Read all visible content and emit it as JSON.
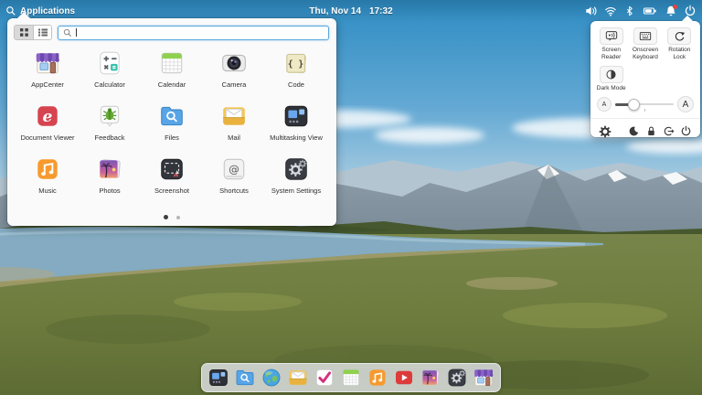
{
  "topbar": {
    "app_menu_label": "Applications",
    "date": "Thu, Nov 14",
    "time": "17:32",
    "tray_icons": [
      "volume-icon",
      "wifi-icon",
      "bluetooth-icon",
      "battery-icon",
      "notifications-icon",
      "power-icon"
    ],
    "notification_badge_color": "#e2453e"
  },
  "launcher": {
    "view_toggles": [
      "grid-view",
      "category-view"
    ],
    "search": {
      "value": "",
      "placeholder": ""
    },
    "apps": [
      {
        "label": "AppCenter"
      },
      {
        "label": "Calculator"
      },
      {
        "label": "Calendar"
      },
      {
        "label": "Camera"
      },
      {
        "label": "Code"
      },
      {
        "label": "Document Viewer"
      },
      {
        "label": "Feedback"
      },
      {
        "label": "Files"
      },
      {
        "label": "Mail"
      },
      {
        "label": "Multitasking View"
      },
      {
        "label": "Music"
      },
      {
        "label": "Photos"
      },
      {
        "label": "Screenshot"
      },
      {
        "label": "Shortcuts"
      },
      {
        "label": "System Settings"
      }
    ],
    "pages": {
      "count": 2,
      "active": 1
    }
  },
  "quick_settings": {
    "toggles": [
      {
        "label": "Screen Reader",
        "icon": "screen-reader-icon"
      },
      {
        "label": "Onscreen Keyboard",
        "icon": "keyboard-icon"
      },
      {
        "label": "Rotation Lock",
        "icon": "rotation-lock-icon"
      },
      {
        "label": "Dark Mode",
        "icon": "dark-mode-icon"
      }
    ],
    "text_size": {
      "small_label": "A",
      "large_label": "A",
      "value_percent": 30
    },
    "actions": [
      "settings-icon",
      "suspend-icon",
      "lock-icon",
      "logout-icon",
      "shutdown-icon"
    ]
  },
  "dock": {
    "items": [
      "Multitasking View",
      "Files",
      "Web",
      "Mail",
      "Tasks",
      "Calendar",
      "Music",
      "Videos",
      "Photos",
      "System Settings",
      "AppCenter"
    ]
  },
  "colors": {
    "accent_blue": "#5aa7dd",
    "panel_bg": "#fafafa",
    "sky_top": "#2e8cc3",
    "grass": "#6e7c3e",
    "water": "#84abc1"
  }
}
